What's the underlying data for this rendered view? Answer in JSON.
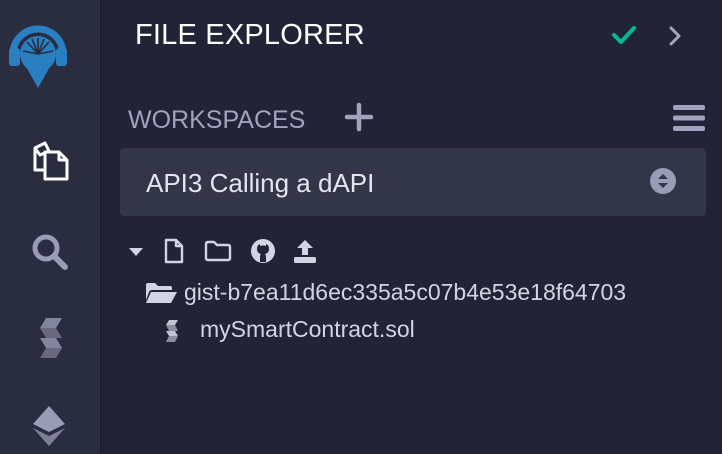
{
  "sidebar": {
    "items": [
      {
        "name": "remix-logo",
        "icon": "remix-logo-icon"
      },
      {
        "name": "file-explorer",
        "icon": "files-icon",
        "active": true
      },
      {
        "name": "search",
        "icon": "search-icon"
      },
      {
        "name": "solidity-compiler",
        "icon": "solidity-icon"
      },
      {
        "name": "deploy-run",
        "icon": "ethereum-icon"
      }
    ]
  },
  "header": {
    "title": "FILE EXPLORER",
    "status_icon": "check-icon",
    "collapse_icon": "chevron-right-icon"
  },
  "workspaces": {
    "label": "WORKSPACES",
    "add_icon": "plus-icon",
    "menu_icon": "hamburger-menu-icon",
    "selected": "API3 Calling a dAPI"
  },
  "tree": {
    "toolbar_icons": [
      "caret-down-icon",
      "new-file-icon",
      "new-folder-icon",
      "github-icon",
      "upload-icon"
    ],
    "folder": {
      "name": "gist-b7ea11d6ec335a5c07b4e53e18f64703",
      "icon": "folder-open-icon"
    },
    "file": {
      "name": "mySmartContract.sol",
      "icon": "solidity-file-icon"
    }
  },
  "colors": {
    "background": "#222336",
    "rail": "#2a2c3f",
    "accent_blue": "#2a7fc1",
    "success": "#00bc8c",
    "text_muted": "#a2a3bd",
    "select_bg": "#333549"
  }
}
